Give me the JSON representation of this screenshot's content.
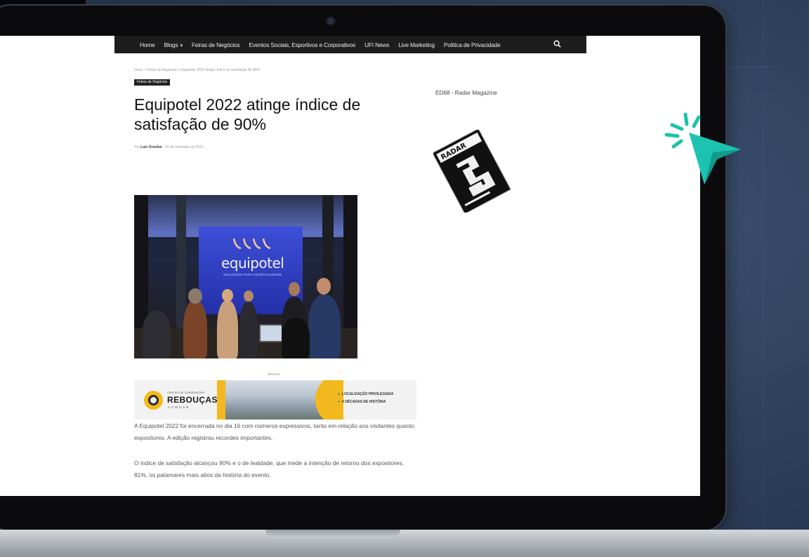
{
  "nav": {
    "items": [
      {
        "label": "Home",
        "caret": false
      },
      {
        "label": "Blogs",
        "caret": true
      },
      {
        "label": "Feiras de Negócios",
        "caret": false
      },
      {
        "label": "Eventos Sociais, Esportivos e Corporativos",
        "caret": false
      },
      {
        "label": "UFI News",
        "caret": false
      },
      {
        "label": "Live Marketing",
        "caret": false
      },
      {
        "label": "Política de Privacidade",
        "caret": false
      }
    ],
    "search_icon": "search-icon"
  },
  "article": {
    "breadcrumb": "Início > Feiras de Negócios > Equipotel 2022 atinge índice de satisfação de 90%",
    "category": "Feiras de Negócios",
    "title": "Equipotel 2022 atinge índice de satisfação de 90%",
    "byline_prefix": "Por",
    "author": "Luiz Orsolon",
    "date": "- 26 de setembro de 2022",
    "photo": {
      "sign": "equipotel",
      "subsign": "SOLUÇÕES PARA HOSPITALIDADE"
    },
    "paragraphs": [
      "A Equipotel 2022 foi encerrada no dia 16 com números expressivos, tanto em relação aos visitantes quanto expositores. A edição registrou recordes importantes.",
      "O índice de satisfação alcançou 90% e o de lealdade, que mede a intenção de retorno dos expositores, 81%, os patamares mais altos da história do evento."
    ]
  },
  "ad": {
    "label": "Anúncio",
    "small_text": "CENTRO DE CONVENÇÕES",
    "name": "REBOUÇAS",
    "sub": "ACMUSB",
    "bullets": [
      "LOCALIZAÇÃO PRIVILEGIADA",
      "4 DÉCADAS DE HISTÓRIA"
    ],
    "colors": {
      "accent": "#f3b81b",
      "bullet": "#0b8fd4"
    }
  },
  "sidebar": {
    "title": "ED68 - Radar Magazine",
    "cover_title": "RADAR"
  }
}
